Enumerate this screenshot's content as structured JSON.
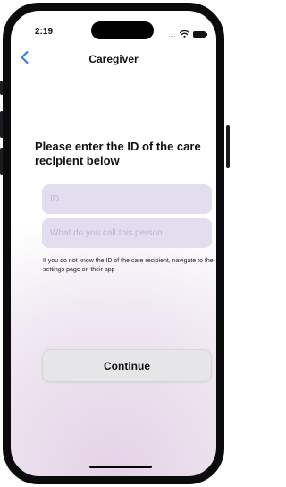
{
  "status_bar": {
    "time": "2:19",
    "signal": "....",
    "icons": [
      "wifi-icon",
      "battery-icon"
    ]
  },
  "nav": {
    "back_icon": "chevron-left-icon",
    "title": "Caregiver"
  },
  "form": {
    "prompt": "Please enter the ID of the care recipient below",
    "id_field": {
      "placeholder": "ID...",
      "value": ""
    },
    "name_field": {
      "placeholder": "What do you call this person...",
      "value": ""
    },
    "hint": "If you do not know the ID of the care recipient, navigate to the settings page on their app",
    "continue_label": "Continue"
  },
  "colors": {
    "accent": "#2f7df6",
    "field_background": "#e2ddef",
    "button_background": "#e6e6e8"
  }
}
